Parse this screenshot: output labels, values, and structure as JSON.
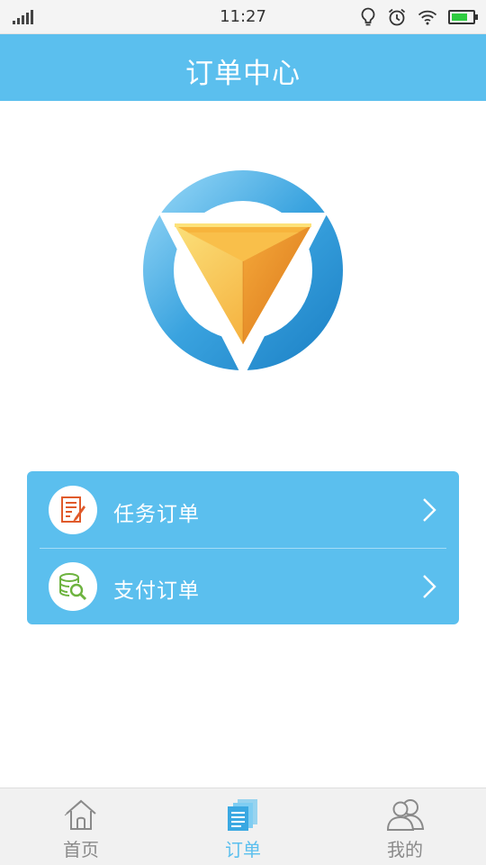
{
  "status_bar": {
    "time": "11:27"
  },
  "header": {
    "title": "订单中心"
  },
  "menu": {
    "items": [
      {
        "label": "任务订单",
        "icon": "task-document-icon"
      },
      {
        "label": "支付订单",
        "icon": "database-search-icon"
      }
    ]
  },
  "tab_bar": {
    "tabs": [
      {
        "label": "首页",
        "icon": "home-icon",
        "active": false
      },
      {
        "label": "订单",
        "icon": "orders-icon",
        "active": true
      },
      {
        "label": "我的",
        "icon": "users-icon",
        "active": false
      }
    ]
  },
  "colors": {
    "primary": "#5bbfee",
    "logo_blue": "#2f9ad8",
    "logo_orange": "#f29a1d",
    "tab_inactive": "#8a8a8a",
    "battery_green": "#2ecc40"
  }
}
